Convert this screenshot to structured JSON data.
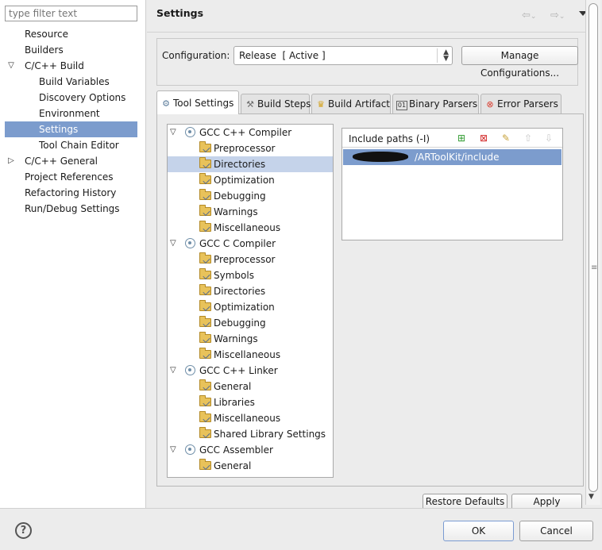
{
  "filter": {
    "placeholder": "type filter text"
  },
  "nav": {
    "items": [
      {
        "label": "Resource"
      },
      {
        "label": "Builders"
      },
      {
        "label": "C/C++ Build"
      },
      {
        "label": "Build Variables"
      },
      {
        "label": "Discovery Options"
      },
      {
        "label": "Environment"
      },
      {
        "label": "Settings"
      },
      {
        "label": "Tool Chain Editor"
      },
      {
        "label": "C/C++ General"
      },
      {
        "label": "Project References"
      },
      {
        "label": "Refactoring History"
      },
      {
        "label": "Run/Debug Settings"
      }
    ],
    "selected": "Settings"
  },
  "header": {
    "title": "Settings",
    "back_glyph": "⇦",
    "forward_glyph": "⇨",
    "dropdown_glyph": "⌄"
  },
  "config": {
    "label": "Configuration:",
    "selected": "Release  [ Active ]",
    "manage_label": "Manage Configurations..."
  },
  "tabs": [
    {
      "label": "Tool Settings",
      "icon": "tool-settings-icon",
      "active": true
    },
    {
      "label": "Build Steps",
      "icon": "build-steps-icon"
    },
    {
      "label": "Build Artifact",
      "icon": "build-artifact-icon"
    },
    {
      "label": "Binary Parsers",
      "icon": "binary-parsers-icon"
    },
    {
      "label": "Error Parsers",
      "icon": "error-parsers-icon"
    }
  ],
  "tool_tree": {
    "groups": [
      {
        "label": "GCC C++ Compiler",
        "children": [
          "Preprocessor",
          "Directories",
          "Optimization",
          "Debugging",
          "Warnings",
          "Miscellaneous"
        ]
      },
      {
        "label": "GCC C Compiler",
        "children": [
          "Preprocessor",
          "Symbols",
          "Directories",
          "Optimization",
          "Debugging",
          "Warnings",
          "Miscellaneous"
        ]
      },
      {
        "label": "GCC C++ Linker",
        "children": [
          "General",
          "Libraries",
          "Miscellaneous",
          "Shared Library Settings"
        ]
      },
      {
        "label": "GCC Assembler",
        "children": [
          "General"
        ]
      }
    ],
    "selected": "GCC C++ Compiler / Directories"
  },
  "include_paths": {
    "title": "Include paths (-I)",
    "items": [
      "/ARToolKit/include"
    ]
  },
  "buttons": {
    "restore_defaults": "Restore Defaults",
    "apply": "Apply",
    "ok": "OK",
    "cancel": "Cancel",
    "help": "?"
  },
  "colors": {
    "selection": "#7c9ccd",
    "tree_selection": "#c5d3ea",
    "background": "#ececec"
  }
}
